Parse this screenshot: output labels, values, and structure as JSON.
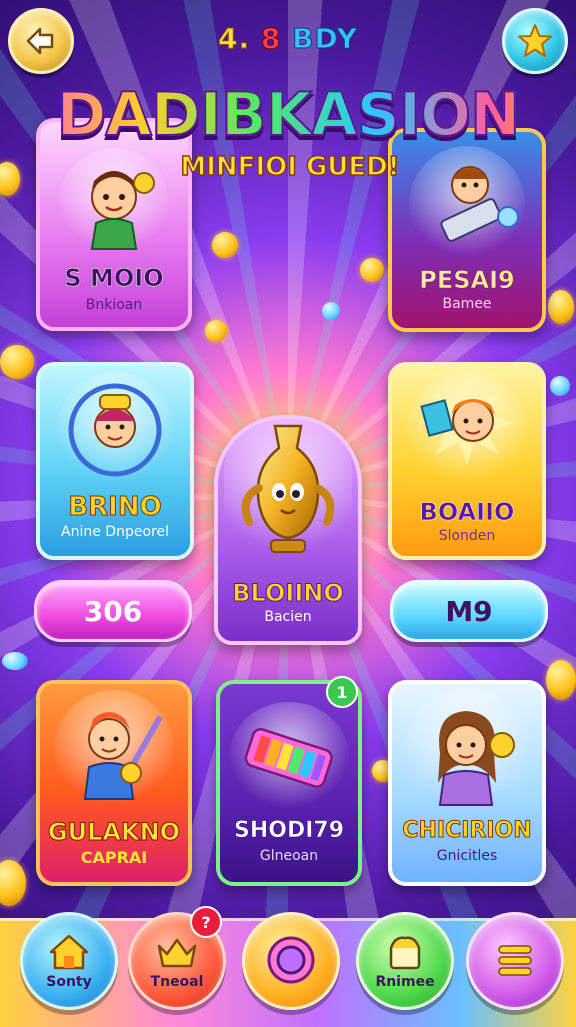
{
  "header": {
    "subtitle_part1": "4.",
    "subtitle_part2": "8",
    "subtitle_part3": "BDY",
    "title": "DADIBKASION",
    "tagline": "MINFIOI GUED!"
  },
  "icons": {
    "back": "home-arrow-icon",
    "star": "star-icon"
  },
  "cards": {
    "top_left": {
      "title": "S MOIO",
      "subtitle": "Bnkioan"
    },
    "top_right": {
      "title": "PESAI9",
      "subtitle": "Bamee"
    },
    "mid_left": {
      "title": "BRINO",
      "subtitle": "Anine Dnpeorel"
    },
    "center": {
      "title": "BLOIINO",
      "subtitle": "Bacien"
    },
    "mid_right": {
      "title": "BOAIIO",
      "subtitle": "Slonden"
    },
    "bottom_left": {
      "title": "GULAKNO",
      "subtitle": "CAPRAI"
    },
    "bottom_center": {
      "title": "SHODI79",
      "subtitle": "Glneoan",
      "badge": "1"
    },
    "bottom_right": {
      "title": "CHICIRION",
      "subtitle": "Gnicitles"
    }
  },
  "pills": {
    "left": "306",
    "right": "M9"
  },
  "nav": {
    "home_label": "Sonty",
    "shop_label": "Tneoal",
    "shop_badge": "?",
    "center_label": "",
    "play_label": "Rnimee",
    "menu_label": ""
  },
  "colors": {
    "title_stroke": "#5a1490",
    "tagline": "#ffe23a",
    "badge_red": "#e81e3a",
    "badge_green": "#3cc850"
  }
}
